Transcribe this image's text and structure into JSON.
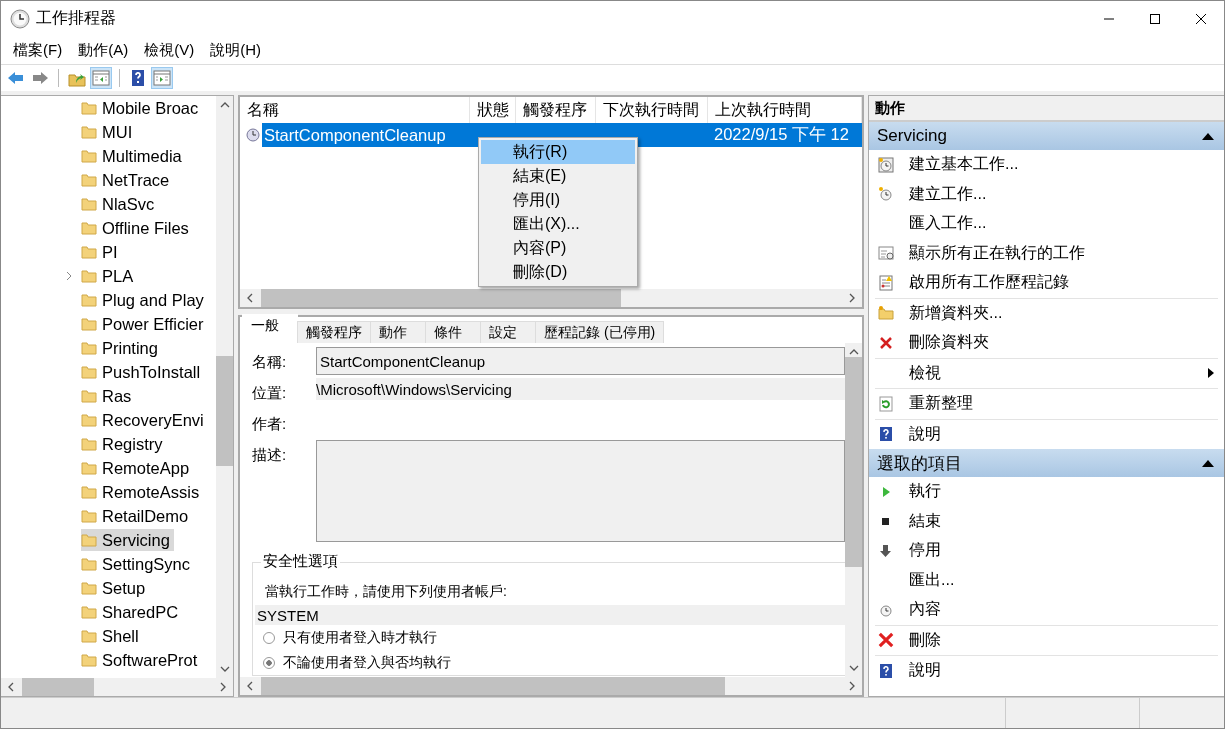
{
  "window": {
    "title": "工作排程器"
  },
  "menu": [
    "檔案(F)",
    "動作(A)",
    "檢視(V)",
    "說明(H)"
  ],
  "toolbar": [
    {
      "kind": "back",
      "on": false
    },
    {
      "kind": "forward",
      "on": false
    },
    {
      "kind": "up",
      "on": false
    },
    {
      "kind": "tree-pane",
      "on": true
    },
    {
      "kind": "help",
      "on": false
    },
    {
      "kind": "action-pane",
      "on": true
    }
  ],
  "tree": {
    "items": [
      {
        "label": "Mobile Broac",
        "selected": false,
        "expandable": false
      },
      {
        "label": "MUI",
        "selected": false,
        "expandable": false
      },
      {
        "label": "Multimedia",
        "selected": false,
        "expandable": false
      },
      {
        "label": "NetTrace",
        "selected": false,
        "expandable": false
      },
      {
        "label": "NlaSvc",
        "selected": false,
        "expandable": false
      },
      {
        "label": "Offline Files",
        "selected": false,
        "expandable": false
      },
      {
        "label": "PI",
        "selected": false,
        "expandable": false
      },
      {
        "label": "PLA",
        "selected": false,
        "expandable": true
      },
      {
        "label": "Plug and Play",
        "selected": false,
        "expandable": false
      },
      {
        "label": "Power Efficier",
        "selected": false,
        "expandable": false
      },
      {
        "label": "Printing",
        "selected": false,
        "expandable": false
      },
      {
        "label": "PushToInstall",
        "selected": false,
        "expandable": false
      },
      {
        "label": "Ras",
        "selected": false,
        "expandable": false
      },
      {
        "label": "RecoveryEnvi",
        "selected": false,
        "expandable": false
      },
      {
        "label": "Registry",
        "selected": false,
        "expandable": false
      },
      {
        "label": "RemoteApp",
        "selected": false,
        "expandable": false
      },
      {
        "label": "RemoteAssis",
        "selected": false,
        "expandable": false
      },
      {
        "label": "RetailDemo",
        "selected": false,
        "expandable": false
      },
      {
        "label": "Servicing",
        "selected": true,
        "expandable": false
      },
      {
        "label": "SettingSync",
        "selected": false,
        "expandable": false
      },
      {
        "label": "Setup",
        "selected": false,
        "expandable": false
      },
      {
        "label": "SharedPC",
        "selected": false,
        "expandable": false
      },
      {
        "label": "Shell",
        "selected": false,
        "expandable": false
      },
      {
        "label": "SoftwareProt",
        "selected": false,
        "expandable": false
      }
    ]
  },
  "task_list": {
    "columns": [
      "名稱",
      "狀態",
      "觸發程序",
      "下次執行時間",
      "上次執行時間"
    ],
    "rows": [
      {
        "name": "StartComponentCleanup",
        "last_run": "2022/9/15 下午 12",
        "selected": true
      }
    ]
  },
  "context_menu": {
    "items": [
      {
        "label": "執行(R)",
        "selected": true
      },
      {
        "label": "結束(E)",
        "selected": false
      },
      {
        "label": "停用(I)",
        "selected": false
      },
      {
        "label": "匯出(X)...",
        "selected": false
      },
      {
        "label": "內容(P)",
        "selected": false
      },
      {
        "label": "刪除(D)",
        "selected": false
      }
    ]
  },
  "details": {
    "tabs": [
      {
        "label": "一般",
        "selected": true
      },
      {
        "label": "觸發程序",
        "selected": false
      },
      {
        "label": "動作",
        "selected": false
      },
      {
        "label": "條件",
        "selected": false
      },
      {
        "label": "設定",
        "selected": false
      },
      {
        "label": "歷程記錄 (已停用)",
        "selected": false
      }
    ],
    "fields": [
      {
        "label": "名稱:",
        "value": "StartComponentCleanup",
        "kind": "textbox"
      },
      {
        "label": "位置:",
        "value": "\\Microsoft\\Windows\\Servicing",
        "kind": "readonly"
      },
      {
        "label": "作者:",
        "kind": "readonly"
      },
      {
        "label": "描述:",
        "kind": "textarea"
      }
    ],
    "security": {
      "title": "安全性選項",
      "prompt": "當執行工作時，請使用下列使用者帳戶:",
      "account": "SYSTEM",
      "options": [
        {
          "label": "只有使用者登入時才執行",
          "selected": false
        },
        {
          "label": "不論使用者登入與否均執行",
          "selected": true
        }
      ]
    }
  },
  "actions_pane": {
    "title": "動作",
    "sections": [
      {
        "title": "Servicing",
        "expanded": true,
        "items": [
          {
            "label": "建立基本工作...",
            "kind": "basic-task",
            "divider": false,
            "submenu": false
          },
          {
            "label": "建立工作...",
            "kind": "task",
            "divider": false,
            "submenu": false
          },
          {
            "label": "匯入工作...",
            "kind": "none",
            "divider": false,
            "submenu": false
          },
          {
            "label": "顯示所有正在執行的工作",
            "kind": "running",
            "divider": false,
            "submenu": false
          },
          {
            "label": "啟用所有工作歷程記錄",
            "kind": "log",
            "divider": false,
            "submenu": false
          },
          {
            "label": "新增資料夾...",
            "kind": "folder",
            "divider": true,
            "submenu": false
          },
          {
            "label": "刪除資料夾",
            "kind": "delete",
            "divider": false,
            "submenu": false
          },
          {
            "label": "檢視",
            "kind": "none",
            "divider": true,
            "submenu": true
          },
          {
            "label": "重新整理",
            "kind": "refresh",
            "divider": true,
            "submenu": false
          },
          {
            "label": "說明",
            "kind": "help",
            "divider": true,
            "submenu": false
          }
        ]
      },
      {
        "title": "選取的項目",
        "expanded": true,
        "items": [
          {
            "label": "執行",
            "kind": "run",
            "divider": false,
            "submenu": false
          },
          {
            "label": "結束",
            "kind": "stop",
            "divider": false,
            "submenu": false
          },
          {
            "label": "停用",
            "kind": "disable",
            "divider": false,
            "submenu": false
          },
          {
            "label": "匯出...",
            "kind": "none",
            "divider": false,
            "submenu": false
          },
          {
            "label": "內容",
            "kind": "properties",
            "divider": false,
            "submenu": false
          },
          {
            "label": "刪除",
            "kind": "delete-big",
            "divider": true,
            "submenu": false
          },
          {
            "label": "說明",
            "kind": "help",
            "divider": true,
            "submenu": false
          }
        ]
      }
    ]
  }
}
